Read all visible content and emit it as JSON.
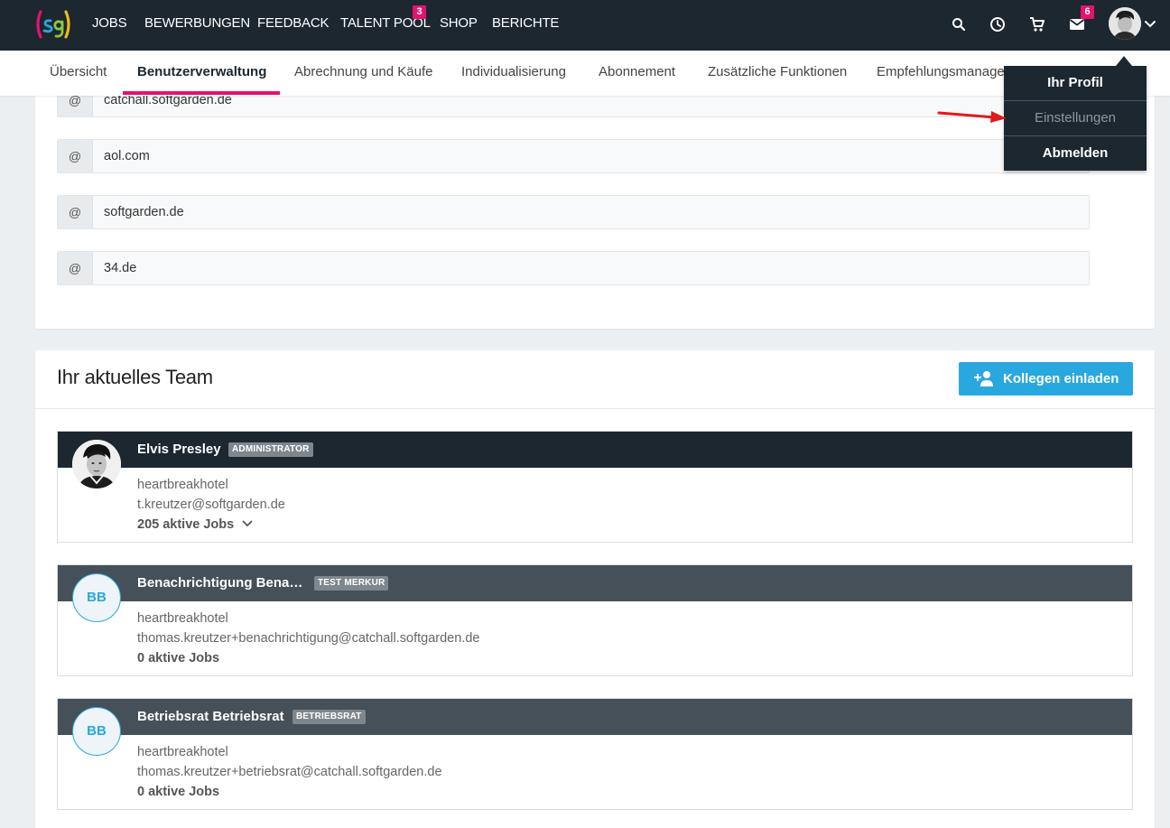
{
  "topnav": {
    "items": [
      "JOBS",
      "BEWERBUNGEN",
      "FEEDBACK",
      "TALENT POOL",
      "SHOP",
      "BERICHTE"
    ],
    "talent_pool_badge": "3",
    "mail_badge": "6",
    "icons": [
      "search-icon",
      "clock-icon",
      "cart-icon",
      "mail-icon"
    ],
    "brand_colors": {
      "nav_bg": "#1c2730",
      "accent": "#e5126f",
      "primary": "#29a8e0"
    }
  },
  "subnav": {
    "tabs": [
      "Übersicht",
      "Benutzerverwaltung",
      "Abrechnung und Käufe",
      "Individualisierung",
      "Abonnement",
      "Zusätzliche Funktionen",
      "Empfehlungsmanage"
    ],
    "active_tab": "Benutzerverwaltung"
  },
  "user_menu": {
    "items": [
      "Ihr Profil",
      "Einstellungen",
      "Abmelden"
    ]
  },
  "domains": {
    "prefix": "@",
    "values": [
      "catchall.softgarden.de",
      "aol.com",
      "softgarden.de",
      "34.de"
    ]
  },
  "team": {
    "title": "Ihr aktuelles Team",
    "invite_label": "Kollegen einladen",
    "members": [
      {
        "name": "Elvis Presley",
        "role": "ADMINISTRATOR",
        "company": "heartbreakhotel",
        "email": "t.kreutzer@softgarden.de",
        "jobs": "205 aktive Jobs"
      },
      {
        "name": "Benachrichtigung Bena…",
        "initials": "BB",
        "role": "TEST MERKUR",
        "company": "heartbreakhotel",
        "email": "thomas.kreutzer+benachrichtigung@catchall.softgarden.de",
        "jobs": "0 aktive Jobs"
      },
      {
        "name": "Betriebsrat Betriebsrat",
        "initials": "BB",
        "role": "BETRIEBSRAT",
        "company": "heartbreakhotel",
        "email": "thomas.kreutzer+betriebsrat@catchall.softgarden.de",
        "jobs": "0 aktive Jobs"
      }
    ]
  }
}
